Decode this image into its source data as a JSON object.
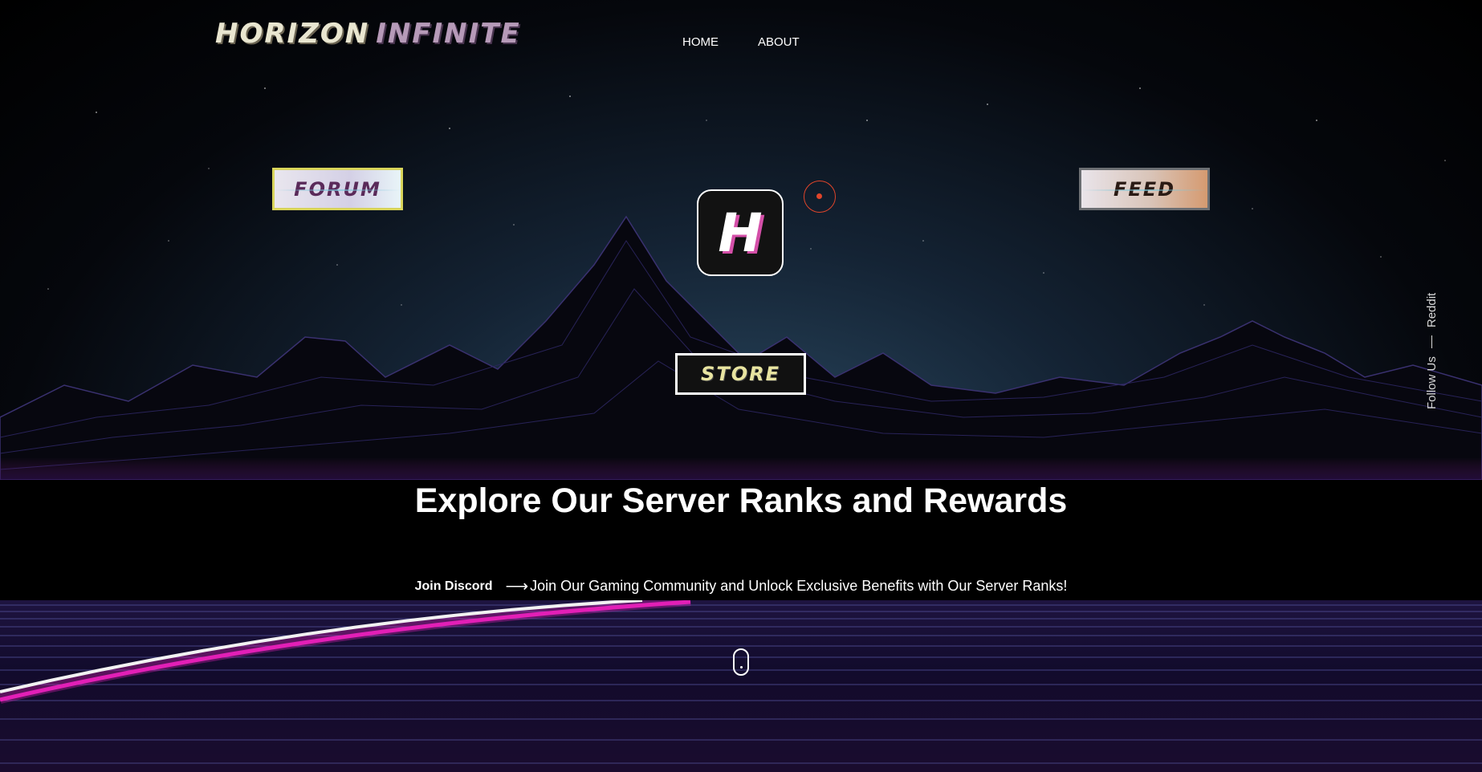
{
  "header": {
    "logo_word1": "HORIZON",
    "logo_word2": "INFINITE",
    "nav": [
      {
        "label": "HOME"
      },
      {
        "label": "ABOUT"
      }
    ]
  },
  "hero": {
    "forum_label": "FORUM",
    "feed_label": "FEED",
    "store_label": "STORE",
    "app_icon_letter": "H"
  },
  "social": {
    "follow_label": "Follow Us",
    "reddit_label": "Reddit"
  },
  "main": {
    "headline": "Explore Our Server Ranks and Rewards",
    "join_label": "Join Discord",
    "arrow": "⟶",
    "tagline": "Join Our Gaming Community and Unlock Exclusive Benefits with Our Server Ranks!"
  },
  "colors": {
    "accent_pink": "#e21fb6",
    "forum_border": "#d8d45a",
    "target_red": "#e0452a"
  }
}
